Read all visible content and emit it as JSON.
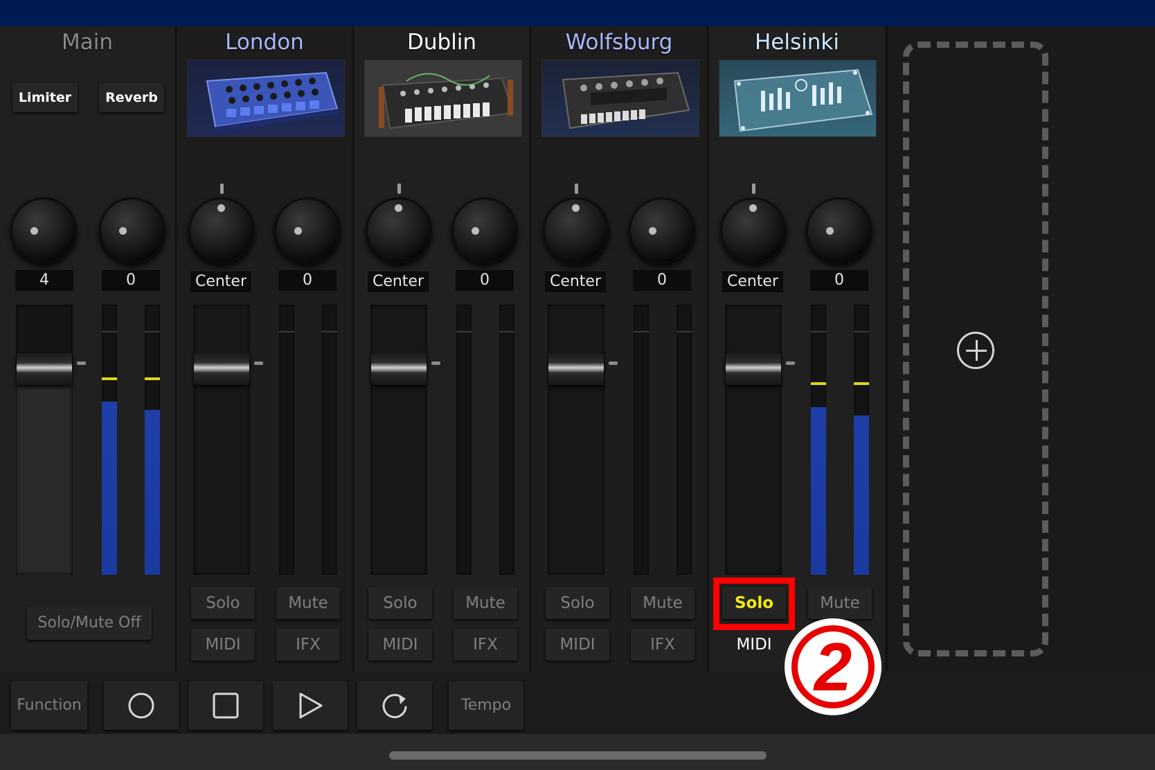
{
  "channels": {
    "main": {
      "name": "Main",
      "plugins": [
        "Limiter",
        "Reverb"
      ],
      "left_value": "4",
      "right_value": "0",
      "solo_mute_off": "Solo/Mute Off"
    },
    "london": {
      "name": "London",
      "pan": "Center",
      "send": "0",
      "solo": "Solo",
      "mute": "Mute",
      "midi": "MIDI",
      "ifx": "IFX"
    },
    "dublin": {
      "name": "Dublin",
      "pan": "Center",
      "send": "0",
      "solo": "Solo",
      "mute": "Mute",
      "midi": "MIDI",
      "ifx": "IFX"
    },
    "wolfsburg": {
      "name": "Wolfsburg",
      "pan": "Center",
      "send": "0",
      "solo": "Solo",
      "mute": "Mute",
      "midi": "MIDI",
      "ifx": "IFX"
    },
    "helsinki": {
      "name": "Helsinki",
      "pan": "Center",
      "send": "0",
      "solo": "Solo",
      "mute": "Mute",
      "midi": "MIDI"
    }
  },
  "transport": {
    "function_label": "Function",
    "tempo_label": "Tempo"
  },
  "annotation": {
    "step": "2"
  },
  "meters": {
    "main_left_level": 0.64,
    "main_right_level": 0.61,
    "helsinki_left_level": 0.62,
    "helsinki_right_level": 0.59
  },
  "colors": {
    "title_bar": "#001b52",
    "highlight": "#ff0000",
    "solo_active": "#f4ea17",
    "meter_blue": "#1e3fa6"
  }
}
